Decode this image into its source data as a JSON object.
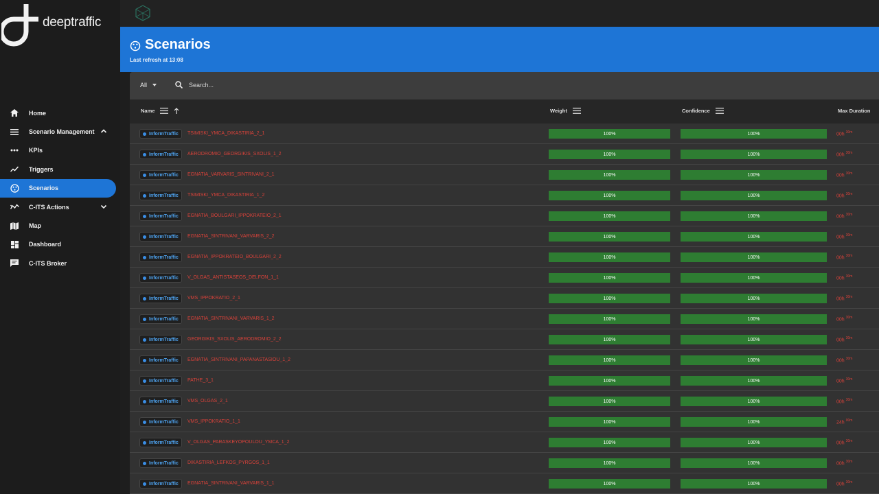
{
  "app": {
    "logo_text_bold": "deep",
    "logo_text_light": "traffic"
  },
  "sidebar": {
    "items": [
      {
        "label": "Home",
        "icon": "home-icon"
      },
      {
        "label": "Scenario Management",
        "icon": "menu-icon",
        "expanded": true
      },
      {
        "label": "KPIs",
        "icon": "dots-icon"
      },
      {
        "label": "Triggers",
        "icon": "trend-icon"
      },
      {
        "label": "Scenarios",
        "icon": "scenario-icon",
        "active": true
      },
      {
        "label": "C-ITS Actions",
        "icon": "actions-icon",
        "expanded": false
      },
      {
        "label": "Map",
        "icon": "map-icon"
      },
      {
        "label": "Dashboard",
        "icon": "dashboard-icon"
      },
      {
        "label": "C-ITS Broker",
        "icon": "chat-icon"
      }
    ]
  },
  "header": {
    "title": "Scenarios",
    "subtitle": "Last refresh at 13:08"
  },
  "toolbar": {
    "filter_value": "All",
    "search_placeholder": "Search..."
  },
  "table": {
    "columns": {
      "name": "Name",
      "weight": "Weight",
      "confidence": "Confidence",
      "max_duration": "Max Duration"
    },
    "rows": [
      {
        "type": "InformTraffic",
        "name": "TSIMISKI_YMCA_DIKASTIRIA_2_1",
        "weight": "100%",
        "confidence": "100%",
        "dur_h": "00h",
        "dur_m": "30m"
      },
      {
        "type": "InformTraffic",
        "name": "AERODROMIO_GEORGIKIS_SXOLIS_1_2",
        "weight": "100%",
        "confidence": "100%",
        "dur_h": "00h",
        "dur_m": "30m"
      },
      {
        "type": "InformTraffic",
        "name": "EGNATIA_VARVARIS_SINTRIVANI_2_1",
        "weight": "100%",
        "confidence": "100%",
        "dur_h": "00h",
        "dur_m": "30m"
      },
      {
        "type": "InformTraffic",
        "name": "TSIMISKI_YMCA_DIKASTIRIA_1_2",
        "weight": "100%",
        "confidence": "100%",
        "dur_h": "00h",
        "dur_m": "30m"
      },
      {
        "type": "InformTraffic",
        "name": "EGNATIA_BOULGARI_IPPOKRATEIO_2_1",
        "weight": "100%",
        "confidence": "100%",
        "dur_h": "00h",
        "dur_m": "30m"
      },
      {
        "type": "InformTraffic",
        "name": "EGNATIA_SINTRIVANI_VARVARIS_2_2",
        "weight": "100%",
        "confidence": "100%",
        "dur_h": "00h",
        "dur_m": "30m"
      },
      {
        "type": "InformTraffic",
        "name": "EGNATIA_IPPOKRATEIO_BOULGARI_2_2",
        "weight": "100%",
        "confidence": "100%",
        "dur_h": "00h",
        "dur_m": "30m"
      },
      {
        "type": "InformTraffic",
        "name": "V_OLGAS_ANTISTASEOS_DELFON_1_1",
        "weight": "100%",
        "confidence": "100%",
        "dur_h": "00h",
        "dur_m": "30m"
      },
      {
        "type": "InformTraffic",
        "name": "VMS_IPPOKRATIO_2_1",
        "weight": "100%",
        "confidence": "100%",
        "dur_h": "00h",
        "dur_m": "30m"
      },
      {
        "type": "InformTraffic",
        "name": "EGNATIA_SINTRIVANI_VARVARIS_1_2",
        "weight": "100%",
        "confidence": "100%",
        "dur_h": "00h",
        "dur_m": "30m"
      },
      {
        "type": "InformTraffic",
        "name": "GEORGIKIS_SXOLIS_AERODROMIO_2_2",
        "weight": "100%",
        "confidence": "100%",
        "dur_h": "00h",
        "dur_m": "30m"
      },
      {
        "type": "InformTraffic",
        "name": "EGNATIA_SINTRIVANI_PAPANASTASIOU_1_2",
        "weight": "100%",
        "confidence": "100%",
        "dur_h": "00h",
        "dur_m": "30m"
      },
      {
        "type": "InformTraffic",
        "name": "PATHE_3_1",
        "weight": "100%",
        "confidence": "100%",
        "dur_h": "00h",
        "dur_m": "30m"
      },
      {
        "type": "InformTraffic",
        "name": "VMS_OLGAS_2_1",
        "weight": "100%",
        "confidence": "100%",
        "dur_h": "00h",
        "dur_m": "30m"
      },
      {
        "type": "InformTraffic",
        "name": "VMS_IPPOKRATIO_1_1",
        "weight": "100%",
        "confidence": "100%",
        "dur_h": "24h",
        "dur_m": "00m"
      },
      {
        "type": "InformTraffic",
        "name": "V_OLGAS_PARASKEYOPOULOU_YMCA_1_2",
        "weight": "100%",
        "confidence": "100%",
        "dur_h": "00h",
        "dur_m": "30m"
      },
      {
        "type": "InformTraffic",
        "name": "DIKASTIRIA_LEFKOS_PYRGOS_1_1",
        "weight": "100%",
        "confidence": "100%",
        "dur_h": "00h",
        "dur_m": "30m"
      },
      {
        "type": "InformTraffic",
        "name": "EGNATIA_SINTRIVANI_VARVARIS_1_1",
        "weight": "100%",
        "confidence": "100%",
        "dur_h": "00h",
        "dur_m": "30m"
      }
    ]
  },
  "colors": {
    "accent": "#1e75d6",
    "bar": "#2e7d32",
    "scenario_name": "#d9423a",
    "chip_text": "#4ea3f0"
  }
}
